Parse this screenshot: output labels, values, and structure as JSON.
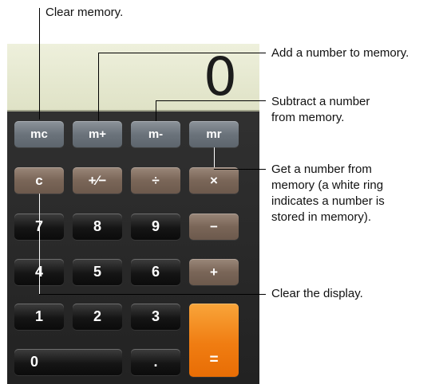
{
  "display": {
    "value": "0"
  },
  "buttons": {
    "memory": [
      "mc",
      "m+",
      "m-",
      "mr"
    ],
    "row2": [
      "c",
      "+⁄−",
      "÷",
      "×"
    ],
    "row3": [
      "7",
      "8",
      "9",
      "−"
    ],
    "row4": [
      "4",
      "5",
      "6",
      "+"
    ],
    "row5": [
      "1",
      "2",
      "3"
    ],
    "row6": [
      "0",
      "."
    ],
    "equals": "="
  },
  "callouts": {
    "clear_memory": "Clear memory.",
    "add_memory": "Add a number to memory.",
    "subtract_memory": [
      "Subtract a number",
      "from memory."
    ],
    "recall_memory": [
      "Get a number from",
      "memory (a white ring",
      "indicates a number is",
      "stored in memory)."
    ],
    "clear_display": "Clear the display."
  },
  "colors": {
    "memory_button": "#6b737b",
    "operator_button": "#7a6658",
    "digit_button": "#151515",
    "equals_button": "#f07d12",
    "display": "#e6e8cf"
  }
}
